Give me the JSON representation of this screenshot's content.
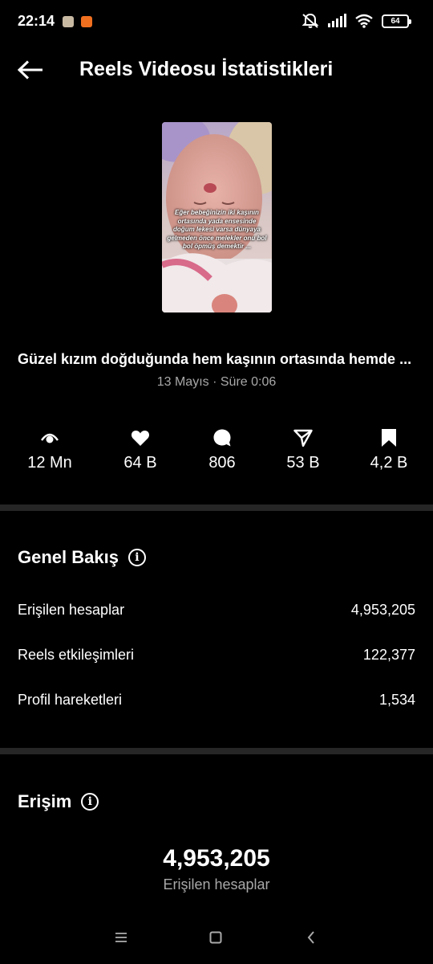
{
  "status_bar": {
    "time": "22:14",
    "battery": "64",
    "icons": [
      "notifications-muted-icon",
      "signal-icon",
      "wifi-icon",
      "battery-icon"
    ]
  },
  "header": {
    "title": "Reels Videosu İstatistikleri",
    "back_icon": "arrow-left-icon"
  },
  "reel": {
    "thumbnail_caption": "Eğer bebeğinizin iki kaşının ortasında yada ensesinde doğum lekesi varsa dünyaya gelmeden önce melekler onu bol bol öpmüş demektir ...",
    "caption": "Güzel kızım doğduğunda hem kaşının ortasında hemde ...",
    "meta": "13 Mayıs · Süre 0:06"
  },
  "metrics": [
    {
      "icon": "eye-icon",
      "value": "12 Mn"
    },
    {
      "icon": "heart-icon",
      "value": "64 B"
    },
    {
      "icon": "comment-icon",
      "value": "806"
    },
    {
      "icon": "share-icon",
      "value": "53 B"
    },
    {
      "icon": "bookmark-icon",
      "value": "4,2 B"
    }
  ],
  "overview": {
    "title": "Genel Bakış",
    "rows": [
      {
        "label": "Erişilen hesaplar",
        "value": "4,953,205"
      },
      {
        "label": "Reels etkileşimleri",
        "value": "122,377"
      },
      {
        "label": "Profil hareketleri",
        "value": "1,534"
      }
    ]
  },
  "reach": {
    "title": "Erişim",
    "number": "4,953,205",
    "label": "Erişilen hesaplar"
  },
  "colors": {
    "background": "#000000",
    "divider": "#262626",
    "secondary_text": "#a8a8a8"
  }
}
